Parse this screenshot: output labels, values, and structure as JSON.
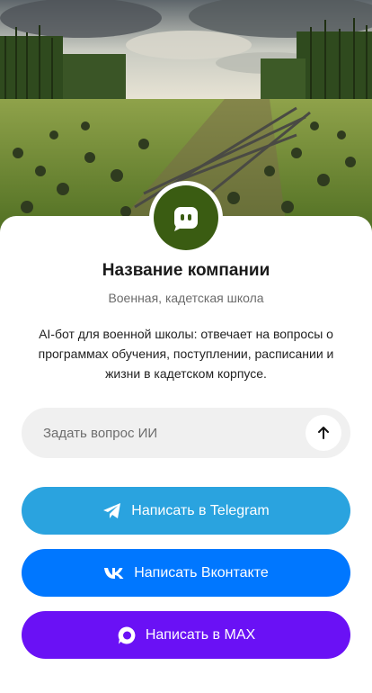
{
  "hero": {
    "image": "military-school-obstacle-course-photo"
  },
  "profile": {
    "avatar_icon": "chat-bot-icon",
    "avatar_color": "#3a5c12",
    "name": "Название компании",
    "category": "Военная, кадетская школа",
    "description": "AI-бот для военной школы: отвечает на вопросы о программах обучения, поступлении, расписании и жизни в кадетском корпусе."
  },
  "ask": {
    "placeholder": "Задать вопрос ИИ",
    "send_icon": "arrow-up-icon"
  },
  "buttons": {
    "telegram": {
      "label": "Написать в Telegram",
      "icon": "telegram-icon",
      "color": "#2aa3df"
    },
    "vk": {
      "label": "Написать Вконтакте",
      "icon": "vk-icon",
      "color": "#0077ff"
    },
    "max": {
      "label": "Написать в MAX",
      "icon": "max-icon",
      "color": "#6a11f5"
    }
  }
}
